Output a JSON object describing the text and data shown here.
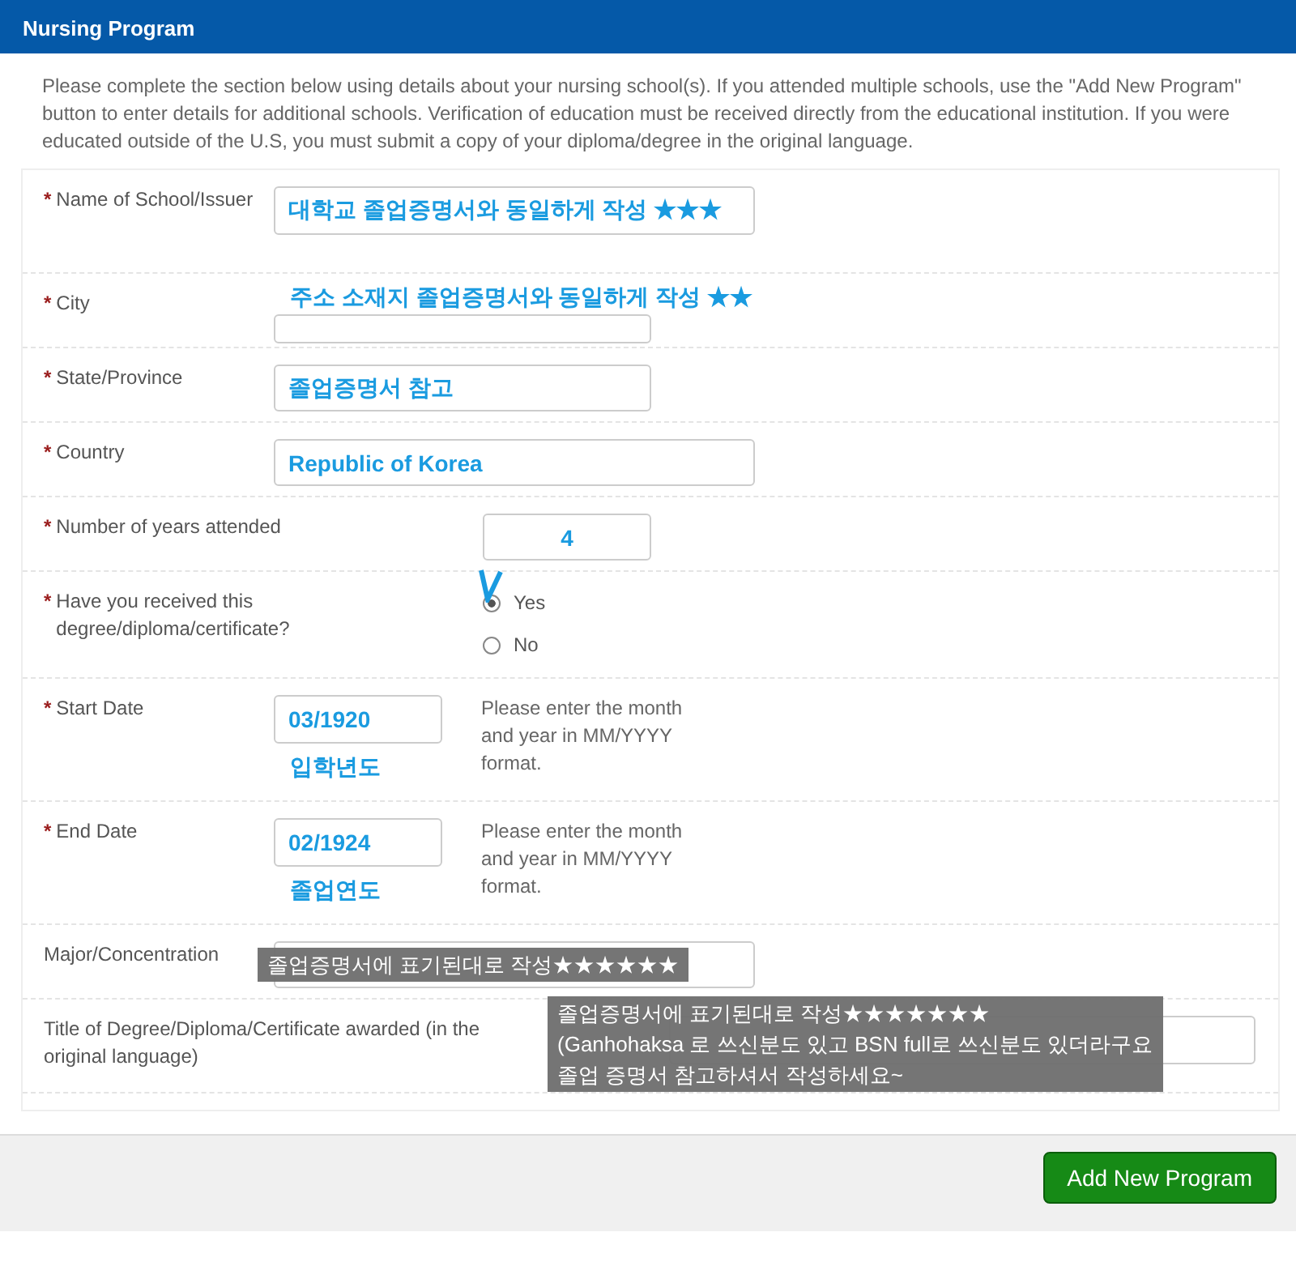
{
  "header": {
    "title": "Nursing Program"
  },
  "intro": "Please complete the section below using details about your nursing school(s). If you attended multiple schools, use the \"Add New Program\" button to enter details for additional schools. Verification of education must be received directly from the educational institution. If you were educated outside of the U.S, you must submit a copy of your diploma/degree in the original language.",
  "fields": [
    {
      "kind": "text",
      "marker": "*",
      "label": "Name of School/Issuer",
      "value": "대학교 졸업증명서와 동일하게 작성 ★★★"
    },
    {
      "kind": "text",
      "marker": "*",
      "label": "City",
      "annotation": "주소 소재지 졸업증명서와 동일하게 작성 ★★"
    },
    {
      "kind": "text",
      "marker": "*",
      "label": "State/Province",
      "value": "졸업증명서 참고"
    },
    {
      "kind": "text",
      "marker": "*",
      "label": "Country",
      "value": "Republic of Korea"
    },
    {
      "kind": "text",
      "marker": "*",
      "label": "Number of years attended",
      "value": "4"
    },
    {
      "kind": "radio",
      "marker": "*",
      "label": "Have you received this degree/diploma/certificate?",
      "options": [
        {
          "label": "Yes",
          "selected": true
        },
        {
          "label": "No",
          "selected": false
        }
      ]
    },
    {
      "kind": "date",
      "marker": "*",
      "label": "Start Date",
      "value": "03/1920",
      "annotation": "입학년도",
      "hint": "Please enter the month and year in MM/YYYY format."
    },
    {
      "kind": "date",
      "marker": "*",
      "label": "End Date",
      "value": "02/1924",
      "annotation": "졸업연도",
      "hint": "Please enter the month and year in MM/YYYY format."
    },
    {
      "kind": "text",
      "label": "Major/Concentration",
      "note": [
        "졸업증명서에 표기된대로 작성★★★★★★"
      ]
    },
    {
      "kind": "title",
      "label": "Title of Degree/Diploma/Certificate awarded (in the original language)",
      "note": [
        "졸업증명서에 표기된대로 작성★★★★★★★",
        "(Ganhohaksa 로 쓰신분도 있고 BSN full로 쓰신분도 있더라구요",
        "졸업 증명서 참고하셔서 작성하세요~"
      ]
    }
  ],
  "footer": {
    "button": "Add New Program"
  }
}
